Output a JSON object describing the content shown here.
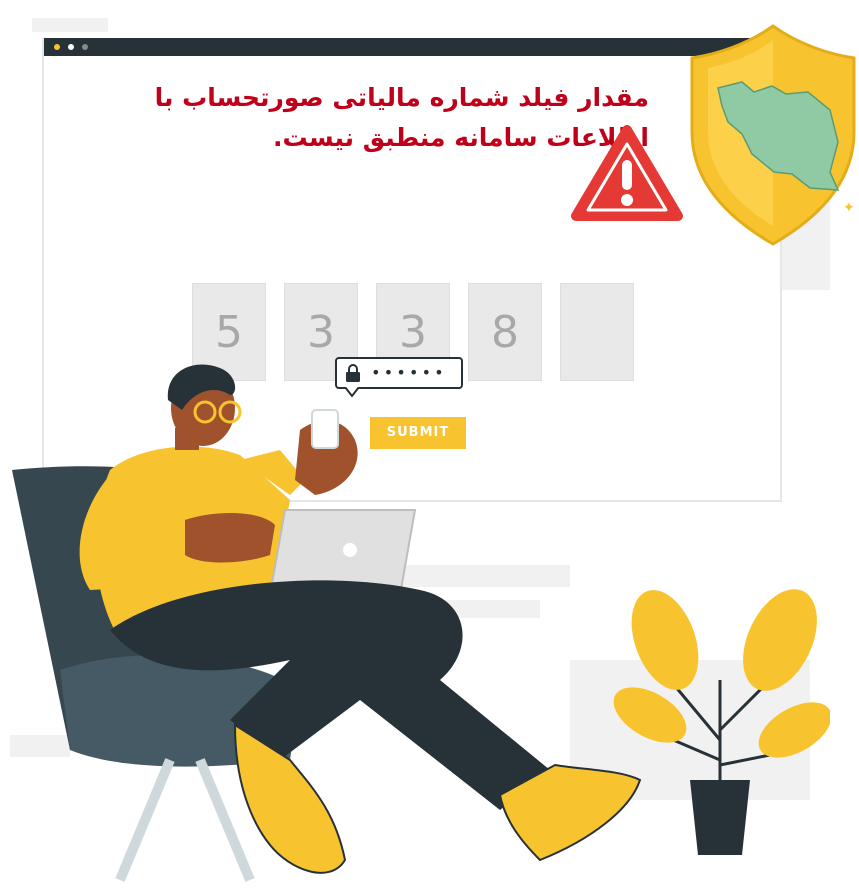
{
  "error_message": {
    "line1": "مقدار فیلد شماره مالیاتی صورتحساب با",
    "line2": "اطلاعات سامانه منطبق نیست."
  },
  "verification_code": {
    "digits": [
      "5",
      "3",
      "3",
      "8",
      ""
    ]
  },
  "password_field": {
    "masked_value": "••••••"
  },
  "submit_button": {
    "label": "SUBMIT"
  },
  "colors": {
    "accent": "#f7c32e",
    "error_text": "#c0001a",
    "warning_red": "#e53935",
    "dark": "#263238",
    "map_green": "#8fcaa4"
  },
  "icons": [
    "warning-triangle-icon",
    "shield-icon",
    "lock-icon"
  ]
}
